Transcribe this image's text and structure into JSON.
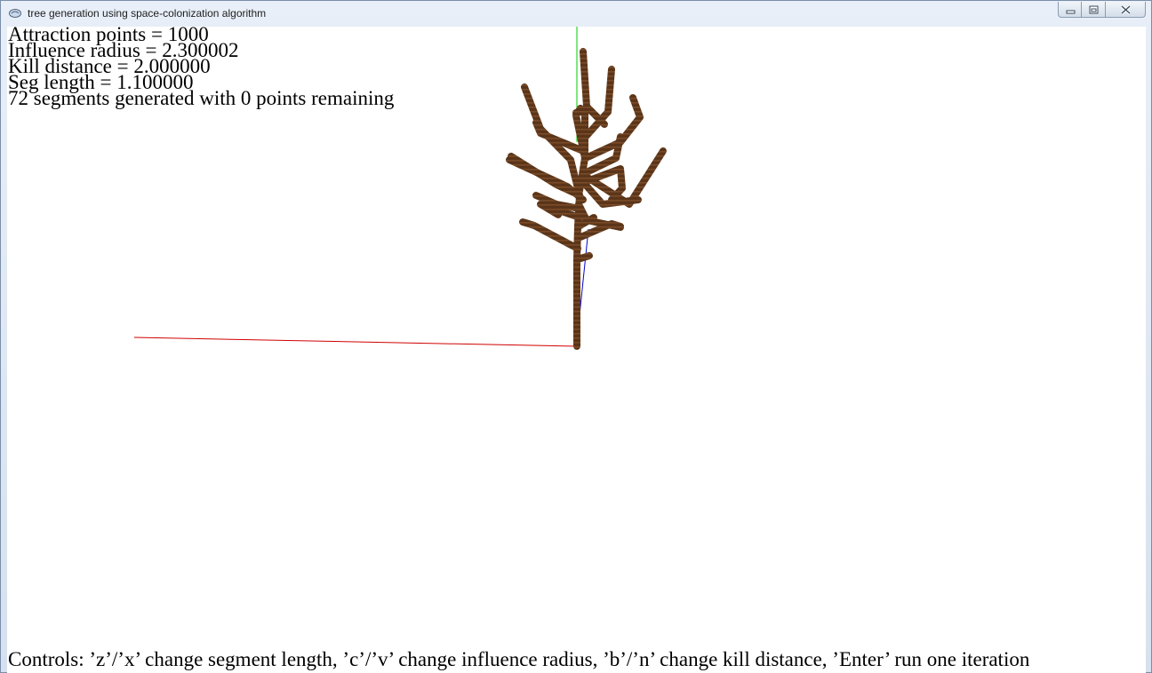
{
  "window": {
    "title": "tree generation using space-colonization algorithm"
  },
  "hud": {
    "attraction_points": "Attraction points = 1000",
    "influence_radius": "Influence radius = 2.300002",
    "kill_distance": "Kill distance = 2.000000",
    "seg_length": "Seg length = 1.100000",
    "status": "72 segments generated with 0 points remaining"
  },
  "controls_text": "Controls: ’z’/’x’ change segment length, ’c’/’v’ change influence radius, ’b’/’n’ change kill distance, ’Enter’ run one iteration",
  "colors": {
    "branch": "#5a3519",
    "branch_highlight": "#7a4b28",
    "x_axis": "#d00000",
    "y_axis": "#00cc00",
    "z_axis": "#0000cc",
    "background": "#ffffff"
  },
  "icons": {
    "app": "app-icon",
    "minimize": "minimize-icon",
    "maximize": "restore-icon",
    "close": "close-icon"
  }
}
